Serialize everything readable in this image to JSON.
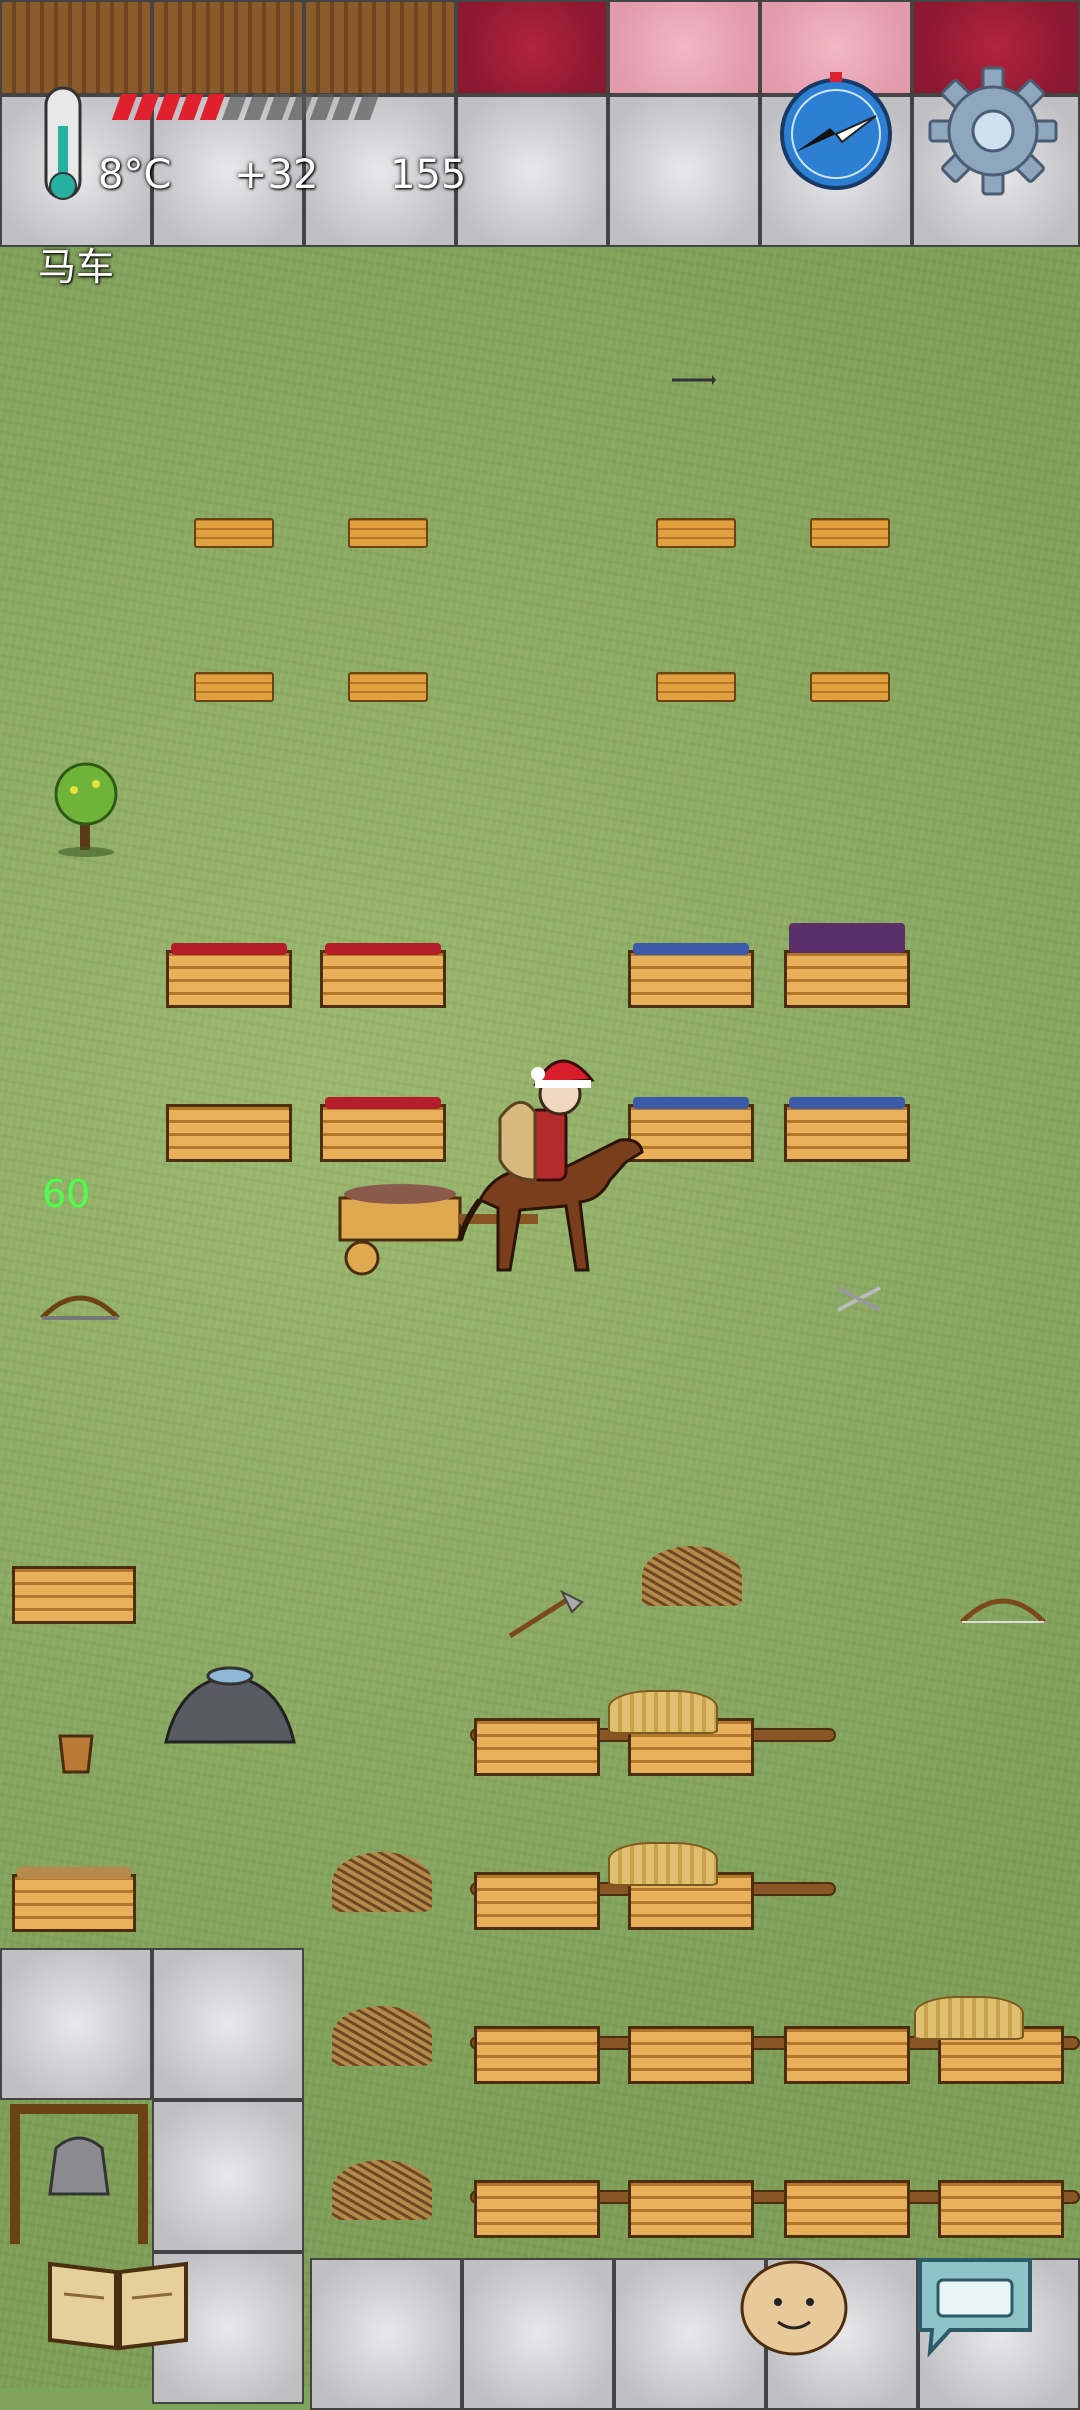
{
  "hud": {
    "temperature": "8°C",
    "score_delta": "+32",
    "count": "155",
    "location": "马车",
    "status_floating": "60",
    "health_segments_filled": 5,
    "health_segments_total": 12
  },
  "icons": {
    "thermometer": "thermometer-icon",
    "compass": "compass-icon",
    "settings": "gear-icon",
    "journal": "book-icon",
    "keyboard": "keyboard-icon",
    "emote": "face-icon"
  },
  "colors": {
    "health": "#e0202c",
    "status_floating": "#4cff4c",
    "compass": "#2d7fd4"
  }
}
